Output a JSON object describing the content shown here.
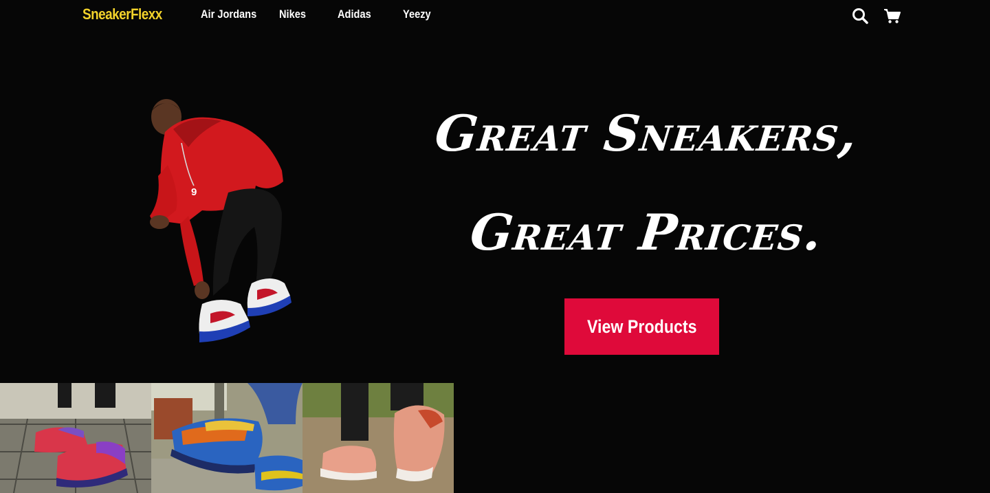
{
  "nav": {
    "logo": "SneakerFlexx",
    "links": [
      "Air Jordans",
      "Nikes",
      "Adidas",
      "Yeezy"
    ],
    "search_icon": "search-icon",
    "cart_icon": "shopping-cart-icon"
  },
  "hero": {
    "headline_line1": "Great Sneakers,",
    "headline_line2": "Great Prices.",
    "cta_label": "View Products",
    "image": "man in red sweatshirt tying sneakers"
  },
  "gallery": {
    "images": [
      "person tying red and purple sneakers on tiled floor",
      "colorful blue sneakers on street curb",
      "pink running shoes on path"
    ]
  },
  "colors": {
    "background": "#060606",
    "logo": "#f2d22a",
    "cta": "#df0a3a",
    "text": "#ffffff"
  }
}
